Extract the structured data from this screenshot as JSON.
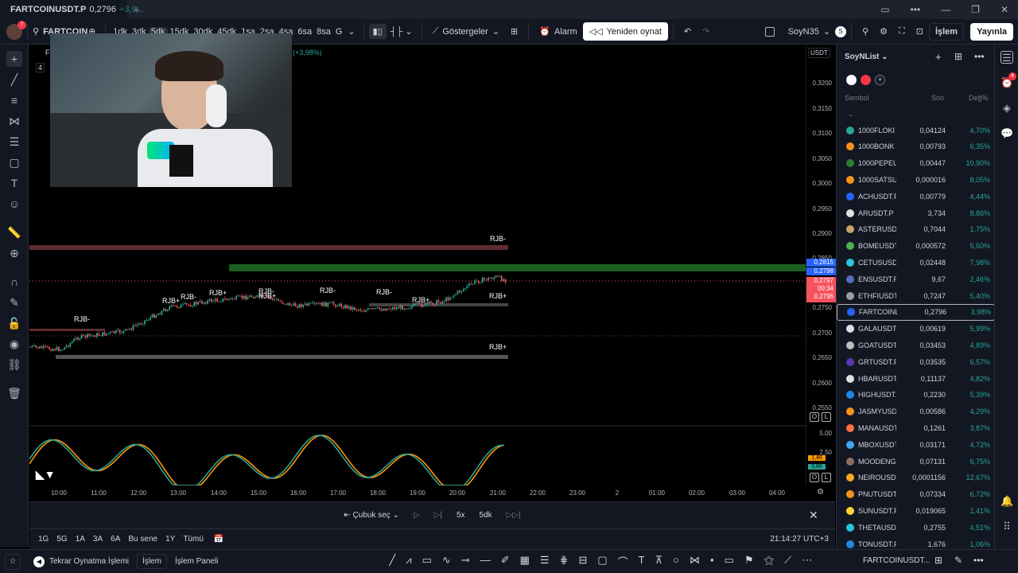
{
  "tab": {
    "title": "FARTCOINUSDT.P",
    "price": "0,2796",
    "change": "+3,9..."
  },
  "window_buttons": [
    "▭",
    "•••",
    "—",
    "❐",
    "✕"
  ],
  "toolbar": {
    "avatar_badge": "7",
    "symbol": "FARTCOINL",
    "intervals": [
      "1dk",
      "3dk",
      "5dk",
      "15dk",
      "30dk",
      "45dk",
      "1sa",
      "2sa",
      "4sa",
      "6sa",
      "8sa",
      "G"
    ],
    "active_interval": "5dk",
    "indicators": "Göstergeler",
    "alarm": "Alarm",
    "replay": "Yeniden oynat",
    "layout_name": "SoyN35",
    "layout_badge": "S",
    "trade": "İşlem",
    "publish": "Yayınla"
  },
  "chart": {
    "legend_change": "(+3,98%)",
    "legend_prefix": "F",
    "legend_num": "4",
    "currency": "USDT",
    "price_labels": [
      "0,3200",
      "0,3150",
      "0,3100",
      "0,3050",
      "0,3000",
      "0,2950",
      "0,2900",
      "0,2850",
      "0,2750",
      "0,2700",
      "0,2650",
      "0,2600",
      "0,2550"
    ],
    "price_tags": {
      "green_top": "0,2815",
      "blue": "0,2798",
      "red1": "0,2797",
      "countdown": "00:34",
      "red2": "0,2796"
    },
    "rjb_labels": [
      "RJB-",
      "RJB-",
      "RJB+",
      "RJB-",
      "RJB+",
      "RJB-",
      "RJB+",
      "RJB-",
      "RJB-",
      "RJB+",
      "RJB+",
      "RJB+"
    ],
    "osc_labels": {
      "top": "5,00",
      "mid": "2,50",
      "a": "1,46",
      "b": "0,66"
    },
    "time_labels": [
      "10:00",
      "11:00",
      "12:00",
      "13:00",
      "14:00",
      "15:00",
      "16:00",
      "17:00",
      "18:00",
      "19:00",
      "20:00",
      "21:00",
      "22:00",
      "23:00",
      "2",
      "01:00",
      "02:00",
      "03:00",
      "04:00"
    ],
    "axis_buttons": [
      "O",
      "L"
    ]
  },
  "replay_bar": {
    "select": "Çubuk seç",
    "speed": "5x",
    "interval": "5dk"
  },
  "range_bar": {
    "ranges": [
      "1G",
      "5G",
      "1A",
      "3A",
      "6A",
      "Bu sene",
      "1Y",
      "Tümü"
    ],
    "clock": "21:14:27 UTC+3"
  },
  "bottom_bar": {
    "replay_trade": "Tekrar Oynatma İşlemi",
    "trade": "İşlem",
    "panel": "İşlem Paneli",
    "symbol": "FARTCOINUSDT..."
  },
  "watchlist": {
    "title": "SoyNList",
    "columns": {
      "symbol": "Sembol",
      "last": "Son",
      "change": "Değ%"
    },
    "rows": [
      {
        "symbol": "1000FLOKI",
        "last": "0,04124",
        "change": "4,70%",
        "color": "#26a69a"
      },
      {
        "symbol": "1000BONK",
        "last": "0,00793",
        "change": "6,35%",
        "color": "#f7931a"
      },
      {
        "symbol": "1000PEPEU",
        "last": "0,00447",
        "change": "10,90%",
        "color": "#2e7d32"
      },
      {
        "symbol": "1000SATSU",
        "last": "0,000016",
        "change": "8,05%",
        "color": "#f7931a"
      },
      {
        "symbol": "ACHUSDT.P",
        "last": "0,00779",
        "change": "4,44%",
        "color": "#2962ff"
      },
      {
        "symbol": "ARUSDT.P",
        "last": "3,734",
        "change": "8,86%",
        "color": "#e0e0e0"
      },
      {
        "symbol": "ASTERUSD",
        "last": "0,7044",
        "change": "1,75%",
        "color": "#c9a36b"
      },
      {
        "symbol": "BOMEUSDT",
        "last": "0,000572",
        "change": "5,50%",
        "color": "#4caf50"
      },
      {
        "symbol": "CETUSUSD",
        "last": "0,02448",
        "change": "7,98%",
        "color": "#26c6da"
      },
      {
        "symbol": "ENSUSDT.P",
        "last": "9,67",
        "change": "2,46%",
        "color": "#5c6bc0"
      },
      {
        "symbol": "ETHFIUSDT",
        "last": "0,7247",
        "change": "5,40%",
        "color": "#9e9e9e"
      },
      {
        "symbol": "FARTCOINL",
        "last": "0,2796",
        "change": "3,98%",
        "color": "#2962ff"
      },
      {
        "symbol": "GALAUSDT.",
        "last": "0,00619",
        "change": "5,99%",
        "color": "#e0e0e0"
      },
      {
        "symbol": "GOATUSDT.",
        "last": "0,03453",
        "change": "4,89%",
        "color": "#bdbdbd"
      },
      {
        "symbol": "GRTUSDT.P",
        "last": "0,03535",
        "change": "6,57%",
        "color": "#5e35b1"
      },
      {
        "symbol": "HBARUSDT.",
        "last": "0,11137",
        "change": "4,82%",
        "color": "#e0e0e0"
      },
      {
        "symbol": "HIGHUSDT.",
        "last": "0,2230",
        "change": "5,39%",
        "color": "#1e88e5"
      },
      {
        "symbol": "JASMYUSDT",
        "last": "0,00586",
        "change": "4,29%",
        "color": "#f7931a"
      },
      {
        "symbol": "MANAUSDT",
        "last": "0,1261",
        "change": "3,87%",
        "color": "#ff7043"
      },
      {
        "symbol": "MBOXUSDT",
        "last": "0,03171",
        "change": "4,72%",
        "color": "#42a5f5"
      },
      {
        "symbol": "MOODENGU",
        "last": "0,07131",
        "change": "6,75%",
        "color": "#8d6e63"
      },
      {
        "symbol": "NEIROUSDT",
        "last": "0,0001156",
        "change": "12,67%",
        "color": "#f9a825"
      },
      {
        "symbol": "PNUTUSDT.",
        "last": "0,07334",
        "change": "6,72%",
        "color": "#f7931a"
      },
      {
        "symbol": "SUNUSDT.P",
        "last": "0,019065",
        "change": "1,41%",
        "color": "#fdd835"
      },
      {
        "symbol": "THETAUSDT",
        "last": "0,2755",
        "change": "4,51%",
        "color": "#26c6da"
      },
      {
        "symbol": "TONUSDT.P",
        "last": "1,676",
        "change": "1,06%",
        "color": "#1e88e5"
      }
    ],
    "selected": 11
  },
  "right_badge": "4"
}
